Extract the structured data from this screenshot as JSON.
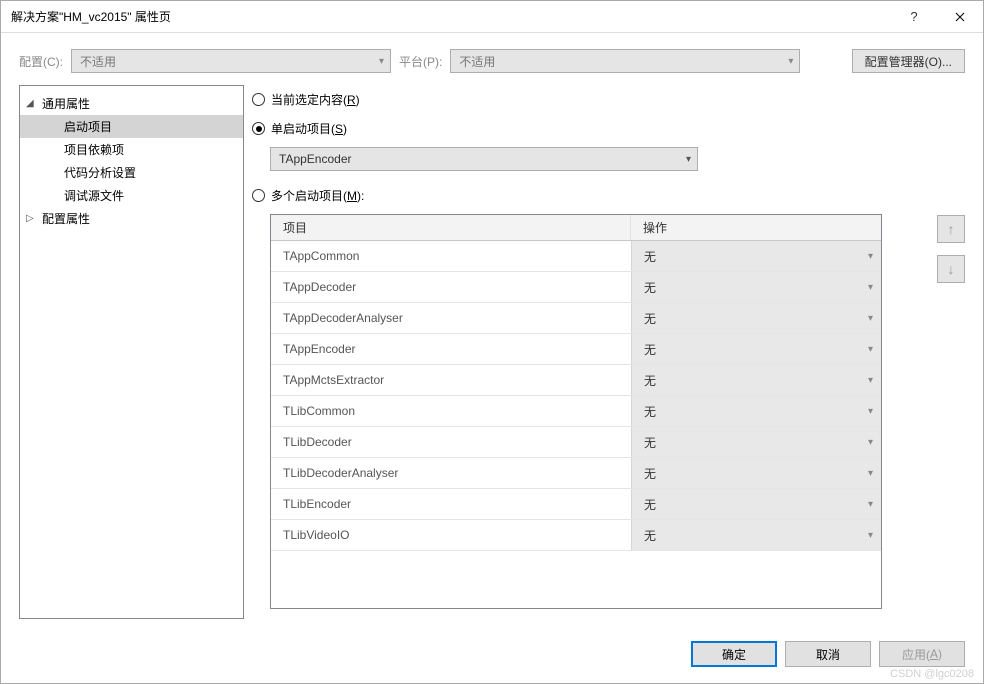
{
  "title": "解决方案\"HM_vc2015\" 属性页",
  "configBar": {
    "configLabel": "配置(C):",
    "configValue": "不适用",
    "platformLabel": "平台(P):",
    "platformValue": "不适用",
    "managerBtn": "配置管理器(O)..."
  },
  "tree": {
    "commonProps": "通用属性",
    "startup": "启动项目",
    "projectDeps": "项目依赖项",
    "codeAnalysis": "代码分析设置",
    "debugSource": "调试源文件",
    "configProps": "配置属性"
  },
  "radios": {
    "current": "当前选定内容(R)",
    "single": "单启动项目(S)",
    "multi": "多个启动项目(M):"
  },
  "singleDropdown": "TAppEncoder",
  "table": {
    "headerProj": "项目",
    "headerOp": "操作",
    "rows": [
      {
        "proj": "TAppCommon",
        "op": "无"
      },
      {
        "proj": "TAppDecoder",
        "op": "无"
      },
      {
        "proj": "TAppDecoderAnalyser",
        "op": "无"
      },
      {
        "proj": "TAppEncoder",
        "op": "无"
      },
      {
        "proj": "TAppMctsExtractor",
        "op": "无"
      },
      {
        "proj": "TLibCommon",
        "op": "无"
      },
      {
        "proj": "TLibDecoder",
        "op": "无"
      },
      {
        "proj": "TLibDecoderAnalyser",
        "op": "无"
      },
      {
        "proj": "TLibEncoder",
        "op": "无"
      },
      {
        "proj": "TLibVideoIO",
        "op": "无"
      }
    ]
  },
  "footer": {
    "ok": "确定",
    "cancel": "取消",
    "apply": "应用(A)"
  },
  "watermark": "CSDN @lgc0208"
}
